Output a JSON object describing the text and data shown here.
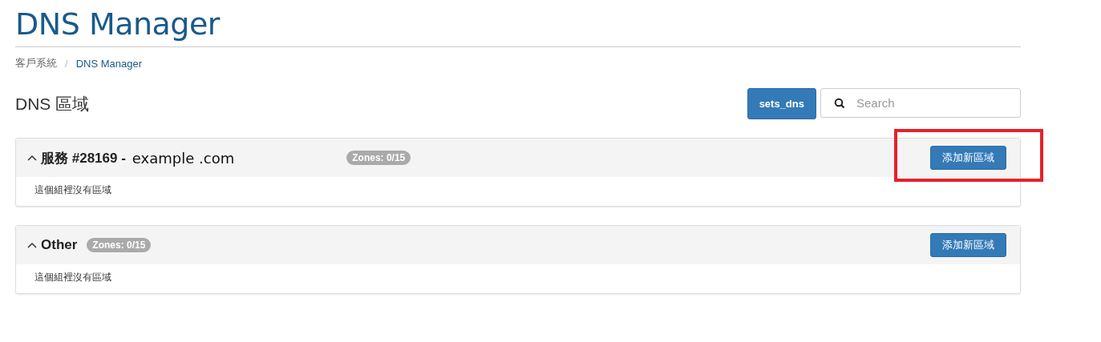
{
  "page_title": "DNS Manager",
  "breadcrumb_separator": "/",
  "breadcrumb": [
    {
      "label": "客戶系統",
      "current": false
    },
    {
      "label": "DNS Manager",
      "current": true
    }
  ],
  "section_title": "DNS 區域",
  "toolbar": {
    "button": "sets_dns",
    "search": {
      "placeholder": "Search"
    }
  },
  "groups": [
    {
      "title": "服務 #28169 -",
      "domain": "example .com",
      "badge": "Zones: 0/15",
      "expanded": true,
      "highlighted": true,
      "button": "添加新區域",
      "empty_text": "這個組裡沒有區域"
    },
    {
      "title": "Other",
      "badge": "Zones: 0/15",
      "expanded": true,
      "highlighted": false,
      "button": "添加新區域",
      "empty_text": "這個組裡沒有區域"
    }
  ]
}
